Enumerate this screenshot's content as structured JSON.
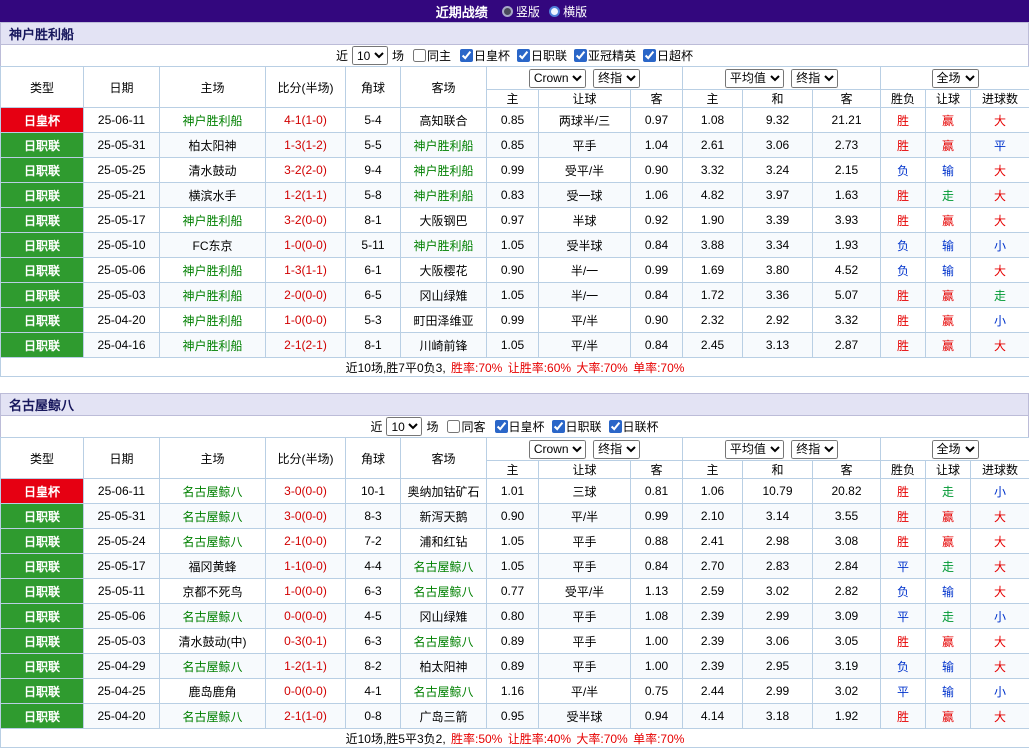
{
  "page": {
    "title": "近期战绩",
    "view_options": [
      {
        "label": "竖版",
        "selected": true
      },
      {
        "label": "横版",
        "selected": false
      }
    ]
  },
  "colors": {
    "topbar_bg": "#33077E",
    "section_header_bg": "#E3E3F4",
    "grid_line": "#B9CFE4",
    "competition_colors": {
      "日皇杯": "#E60012",
      "日职联": "#2F9B2F"
    },
    "focus_team_color": "#008000",
    "score_color": "#D10000",
    "value_colors": {
      "胜": "#E60000",
      "赢": "#E60000",
      "大": "#E60000",
      "负": "#0033CC",
      "输": "#0033CC",
      "小": "#0033CC",
      "平": "#0033CC",
      "走": "#009933"
    },
    "summary_rate_color": "#E60000"
  },
  "header_labels": {
    "static": [
      "类型",
      "日期",
      "主场",
      "比分(半场)",
      "角球",
      "客场"
    ],
    "asian_sub": [
      "主",
      "让球",
      "客"
    ],
    "euro_sub": [
      "主",
      "和",
      "客"
    ],
    "result_sub": [
      "胜负",
      "让球",
      "进球数"
    ]
  },
  "sections": [
    {
      "team": "神户胜利船",
      "filter": {
        "prefix": "近",
        "count": "10",
        "suffix": "场",
        "venue": {
          "label": "同主",
          "checked": false
        },
        "competitions": [
          {
            "label": "日皇杯",
            "checked": true
          },
          {
            "label": "日职联",
            "checked": true
          },
          {
            "label": "亚冠精英",
            "checked": true
          },
          {
            "label": "日超杯",
            "checked": true
          }
        ]
      },
      "selects": {
        "asian_bookmaker": "Crown",
        "asian_stage": "终指",
        "euro_bookmaker": "平均值",
        "euro_stage": "终指",
        "scope": "全场"
      },
      "rows": [
        {
          "comp": "日皇杯",
          "date": "25-06-11",
          "home": "神户胜利船",
          "hf": true,
          "score": "4-1(1-0)",
          "corner": "5-4",
          "away": "高知联合",
          "af": false,
          "ah": [
            "0.85",
            "两球半/三",
            "0.97"
          ],
          "eu": [
            "1.08",
            "9.32",
            "21.21"
          ],
          "res": [
            "胜",
            "赢",
            "大"
          ]
        },
        {
          "comp": "日职联",
          "date": "25-05-31",
          "home": "柏太阳神",
          "hf": false,
          "score": "1-3(1-2)",
          "corner": "5-5",
          "away": "神户胜利船",
          "af": true,
          "ah": [
            "0.85",
            "平手",
            "1.04"
          ],
          "eu": [
            "2.61",
            "3.06",
            "2.73"
          ],
          "res": [
            "胜",
            "赢",
            "平"
          ]
        },
        {
          "comp": "日职联",
          "date": "25-05-25",
          "home": "清水鼓动",
          "hf": false,
          "score": "3-2(2-0)",
          "corner": "9-4",
          "away": "神户胜利船",
          "af": true,
          "ah": [
            "0.99",
            "受平/半",
            "0.90"
          ],
          "eu": [
            "3.32",
            "3.24",
            "2.15"
          ],
          "res": [
            "负",
            "输",
            "大"
          ]
        },
        {
          "comp": "日职联",
          "date": "25-05-21",
          "home": "横滨水手",
          "hf": false,
          "score": "1-2(1-1)",
          "corner": "5-8",
          "away": "神户胜利船",
          "af": true,
          "ah": [
            "0.83",
            "受一球",
            "1.06"
          ],
          "eu": [
            "4.82",
            "3.97",
            "1.63"
          ],
          "res": [
            "胜",
            "走",
            "大"
          ]
        },
        {
          "comp": "日职联",
          "date": "25-05-17",
          "home": "神户胜利船",
          "hf": true,
          "score": "3-2(0-0)",
          "corner": "8-1",
          "away": "大阪钢巴",
          "af": false,
          "ah": [
            "0.97",
            "半球",
            "0.92"
          ],
          "eu": [
            "1.90",
            "3.39",
            "3.93"
          ],
          "res": [
            "胜",
            "赢",
            "大"
          ]
        },
        {
          "comp": "日职联",
          "date": "25-05-10",
          "home": "FC东京",
          "hf": false,
          "score": "1-0(0-0)",
          "corner": "5-11",
          "away": "神户胜利船",
          "af": true,
          "ah": [
            "1.05",
            "受半球",
            "0.84"
          ],
          "eu": [
            "3.88",
            "3.34",
            "1.93"
          ],
          "res": [
            "负",
            "输",
            "小"
          ]
        },
        {
          "comp": "日职联",
          "date": "25-05-06",
          "home": "神户胜利船",
          "hf": true,
          "score": "1-3(1-1)",
          "corner": "6-1",
          "away": "大阪樱花",
          "af": false,
          "ah": [
            "0.90",
            "半/一",
            "0.99"
          ],
          "eu": [
            "1.69",
            "3.80",
            "4.52"
          ],
          "res": [
            "负",
            "输",
            "大"
          ]
        },
        {
          "comp": "日职联",
          "date": "25-05-03",
          "home": "神户胜利船",
          "hf": true,
          "score": "2-0(0-0)",
          "corner": "6-5",
          "away": "冈山绿雉",
          "af": false,
          "ah": [
            "1.05",
            "半/一",
            "0.84"
          ],
          "eu": [
            "1.72",
            "3.36",
            "5.07"
          ],
          "res": [
            "胜",
            "赢",
            "走"
          ]
        },
        {
          "comp": "日职联",
          "date": "25-04-20",
          "home": "神户胜利船",
          "hf": true,
          "score": "1-0(0-0)",
          "corner": "5-3",
          "away": "町田泽维亚",
          "af": false,
          "ah": [
            "0.99",
            "平/半",
            "0.90"
          ],
          "eu": [
            "2.32",
            "2.92",
            "3.32"
          ],
          "res": [
            "胜",
            "赢",
            "小"
          ]
        },
        {
          "comp": "日职联",
          "date": "25-04-16",
          "home": "神户胜利船",
          "hf": true,
          "score": "2-1(2-1)",
          "corner": "8-1",
          "away": "川崎前锋",
          "af": false,
          "ah": [
            "1.05",
            "平/半",
            "0.84"
          ],
          "eu": [
            "2.45",
            "3.13",
            "2.87"
          ],
          "res": [
            "胜",
            "赢",
            "大"
          ]
        }
      ],
      "summary": {
        "prefix": "近10场,胜7平0负3, ",
        "rates": [
          "胜率:70%",
          "让胜率:60%",
          "大率:70%",
          "单率:70%"
        ]
      }
    },
    {
      "team": "名古屋鲸八",
      "filter": {
        "prefix": "近",
        "count": "10",
        "suffix": "场",
        "venue": {
          "label": "同客",
          "checked": false
        },
        "competitions": [
          {
            "label": "日皇杯",
            "checked": true
          },
          {
            "label": "日职联",
            "checked": true
          },
          {
            "label": "日联杯",
            "checked": true
          }
        ]
      },
      "selects": {
        "asian_bookmaker": "Crown",
        "asian_stage": "终指",
        "euro_bookmaker": "平均值",
        "euro_stage": "终指",
        "scope": "全场"
      },
      "rows": [
        {
          "comp": "日皇杯",
          "date": "25-06-11",
          "home": "名古屋鲸八",
          "hf": true,
          "score": "3-0(0-0)",
          "corner": "10-1",
          "away": "奥纳加钴矿石",
          "af": false,
          "ah": [
            "1.01",
            "三球",
            "0.81"
          ],
          "eu": [
            "1.06",
            "10.79",
            "20.82"
          ],
          "res": [
            "胜",
            "走",
            "小"
          ]
        },
        {
          "comp": "日职联",
          "date": "25-05-31",
          "home": "名古屋鲸八",
          "hf": true,
          "score": "3-0(0-0)",
          "corner": "8-3",
          "away": "新泻天鹅",
          "af": false,
          "ah": [
            "0.90",
            "平/半",
            "0.99"
          ],
          "eu": [
            "2.10",
            "3.14",
            "3.55"
          ],
          "res": [
            "胜",
            "赢",
            "大"
          ]
        },
        {
          "comp": "日职联",
          "date": "25-05-24",
          "home": "名古屋鲸八",
          "hf": true,
          "score": "2-1(0-0)",
          "corner": "7-2",
          "away": "浦和红钻",
          "af": false,
          "ah": [
            "1.05",
            "平手",
            "0.88"
          ],
          "eu": [
            "2.41",
            "2.98",
            "3.08"
          ],
          "res": [
            "胜",
            "赢",
            "大"
          ]
        },
        {
          "comp": "日职联",
          "date": "25-05-17",
          "home": "福冈黄蜂",
          "hf": false,
          "score": "1-1(0-0)",
          "corner": "4-4",
          "away": "名古屋鲸八",
          "af": true,
          "ah": [
            "1.05",
            "平手",
            "0.84"
          ],
          "eu": [
            "2.70",
            "2.83",
            "2.84"
          ],
          "res": [
            "平",
            "走",
            "大"
          ]
        },
        {
          "comp": "日职联",
          "date": "25-05-11",
          "home": "京都不死鸟",
          "hf": false,
          "score": "1-0(0-0)",
          "corner": "6-3",
          "away": "名古屋鲸八",
          "af": true,
          "ah": [
            "0.77",
            "受平/半",
            "1.13"
          ],
          "eu": [
            "2.59",
            "3.02",
            "2.82"
          ],
          "res": [
            "负",
            "输",
            "大"
          ]
        },
        {
          "comp": "日职联",
          "date": "25-05-06",
          "home": "名古屋鲸八",
          "hf": true,
          "score": "0-0(0-0)",
          "corner": "4-5",
          "away": "冈山绿雉",
          "af": false,
          "ah": [
            "0.80",
            "平手",
            "1.08"
          ],
          "eu": [
            "2.39",
            "2.99",
            "3.09"
          ],
          "res": [
            "平",
            "走",
            "小"
          ]
        },
        {
          "comp": "日职联",
          "date": "25-05-03",
          "home": "清水鼓动(中)",
          "hf": false,
          "score": "0-3(0-1)",
          "corner": "6-3",
          "away": "名古屋鲸八",
          "af": true,
          "ah": [
            "0.89",
            "平手",
            "1.00"
          ],
          "eu": [
            "2.39",
            "3.06",
            "3.05"
          ],
          "res": [
            "胜",
            "赢",
            "大"
          ]
        },
        {
          "comp": "日职联",
          "date": "25-04-29",
          "home": "名古屋鲸八",
          "hf": true,
          "score": "1-2(1-1)",
          "corner": "8-2",
          "away": "柏太阳神",
          "af": false,
          "ah": [
            "0.89",
            "平手",
            "1.00"
          ],
          "eu": [
            "2.39",
            "2.95",
            "3.19"
          ],
          "res": [
            "负",
            "输",
            "大"
          ]
        },
        {
          "comp": "日职联",
          "date": "25-04-25",
          "home": "鹿岛鹿角",
          "hf": false,
          "score": "0-0(0-0)",
          "corner": "4-1",
          "away": "名古屋鲸八",
          "af": true,
          "ah": [
            "1.16",
            "平/半",
            "0.75"
          ],
          "eu": [
            "2.44",
            "2.99",
            "3.02"
          ],
          "res": [
            "平",
            "输",
            "小"
          ]
        },
        {
          "comp": "日职联",
          "date": "25-04-20",
          "home": "名古屋鲸八",
          "hf": true,
          "score": "2-1(1-0)",
          "corner": "0-8",
          "away": "广岛三箭",
          "af": false,
          "ah": [
            "0.95",
            "受半球",
            "0.94"
          ],
          "eu": [
            "4.14",
            "3.18",
            "1.92"
          ],
          "res": [
            "胜",
            "赢",
            "大"
          ]
        }
      ],
      "summary": {
        "prefix": "近10场,胜5平3负2, ",
        "rates": [
          "胜率:50%",
          "让胜率:40%",
          "大率:70%",
          "单率:70%"
        ]
      }
    }
  ]
}
